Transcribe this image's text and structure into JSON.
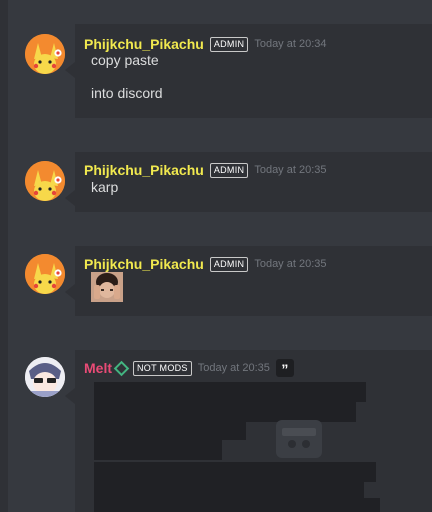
{
  "messages": [
    {
      "author": "Phijkchu_Pikachu",
      "badge": "ADMIN",
      "timestamp": "Today at 20:34",
      "lines": [
        "copy paste",
        "into discord"
      ]
    },
    {
      "author": "Phijkchu_Pikachu",
      "badge": "ADMIN",
      "timestamp": "Today at 20:35",
      "lines": [
        "karp"
      ]
    },
    {
      "author": "Phijkchu_Pikachu",
      "badge": "ADMIN",
      "timestamp": "Today at 20:35",
      "attachment": "face-photo"
    },
    {
      "author": "Melt",
      "badge": "NOT MODS",
      "timestamp": "Today at 20:35",
      "quote_icon": "”",
      "author_icon": "diamond-icon",
      "attachment": "redacted-text-image"
    }
  ],
  "colors": {
    "background": "#36393f",
    "card": "#2f3136",
    "admin_name": "#f1e94f",
    "melt_name": "#e94b76",
    "timestamp": "#72767d",
    "text": "#dcddde"
  }
}
